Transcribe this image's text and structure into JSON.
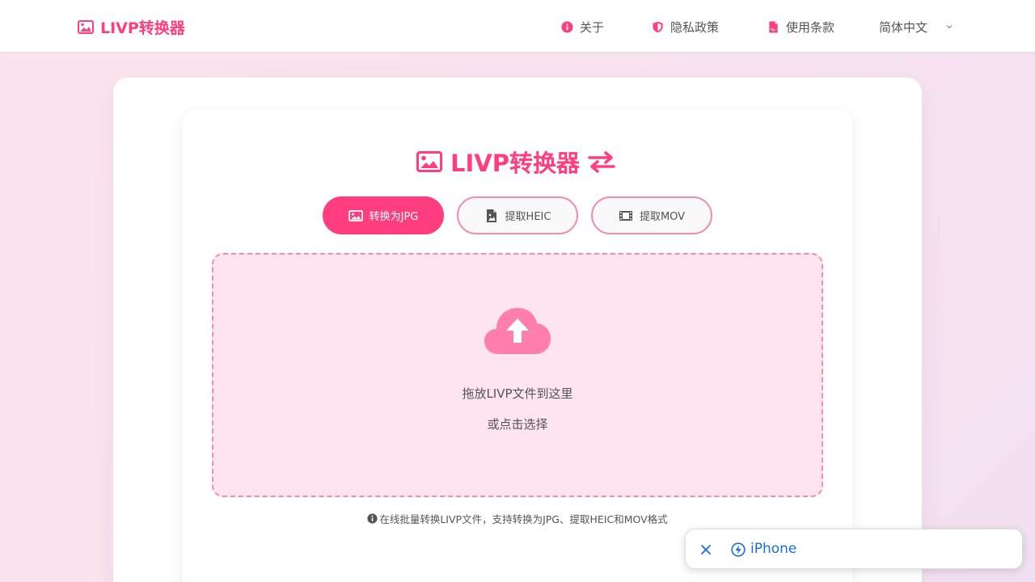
{
  "header": {
    "brand": "LIVP转换器",
    "nav": {
      "about": "关于",
      "privacy": "隐私政策",
      "terms": "使用条款",
      "language": "简体中文"
    }
  },
  "main": {
    "title": "LIVP转换器",
    "tabs": [
      {
        "label": "转换为JPG",
        "icon": "image-icon",
        "active": true
      },
      {
        "label": "提取HEIC",
        "icon": "file-image-icon",
        "active": false
      },
      {
        "label": "提取MOV",
        "icon": "film-icon",
        "active": false
      }
    ],
    "dropzone": {
      "primary": "拖放LIVP文件到这里",
      "secondary": "或点击选择"
    },
    "info": "在线批量转换LIVP文件，支持转换为JPG、提取HEIC和MOV格式"
  },
  "toast": {
    "label": "iPhone"
  },
  "colors": {
    "accent": "#ff3d7f",
    "accent_light": "#f58bb2",
    "dropzone_bg": "#fde4ef",
    "link_blue": "#1a6ed8"
  }
}
